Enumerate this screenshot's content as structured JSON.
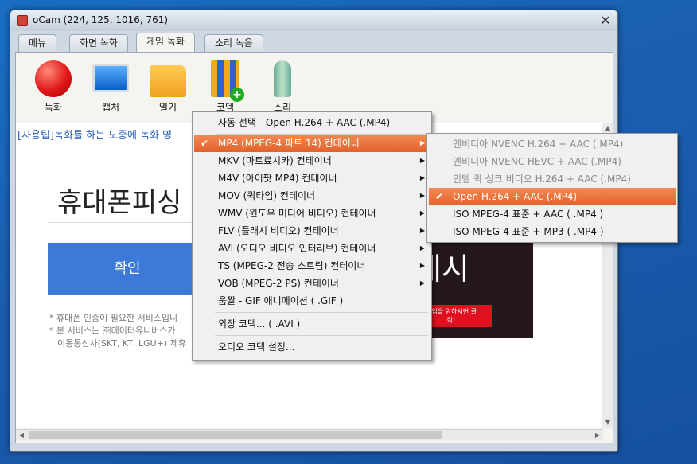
{
  "window": {
    "title": "oCam (224, 125, 1016, 761)",
    "close_glyph": "✕"
  },
  "tabs": [
    {
      "label": "메뉴"
    },
    {
      "label": "화면 녹화"
    },
    {
      "label": "게임 녹화"
    },
    {
      "label": "소리 녹음"
    }
  ],
  "toolbar": {
    "record": "녹화",
    "capture": "캡처",
    "open": "열기",
    "codec": "코덱",
    "sound": "소리"
  },
  "content": {
    "tip": "[사용팁]녹화를 하는 도중에 녹화 영",
    "heading": "휴대폰피싱",
    "confirm_button": "확인",
    "note1": "* 휴대폰 인증이 필요한 서비스입니",
    "note2": "* 본 서비스는 ㈜데이터유니버스가",
    "note3": "이동통신사(SKT, KT, LGU+) 제휴",
    "ad_big": "게시",
    "ad_button": "게임을 원하시면 클릭!",
    "ad_close": "✕"
  },
  "codec_menu": {
    "items": [
      {
        "label": "자동 선택 - Open H.264 + AAC (.MP4)"
      },
      {
        "label": "MP4 (MPEG-4 파트 14) 컨테이너",
        "checked": true,
        "submenu": true
      },
      {
        "label": "MKV (마트료시카) 컨테이너",
        "submenu": true
      },
      {
        "label": "M4V (아이팟 MP4) 컨테이너",
        "submenu": true
      },
      {
        "label": "MOV (퀵타임) 컨테이너",
        "submenu": true
      },
      {
        "label": "WMV (윈도우 미디어 비디오) 컨테이너",
        "submenu": true
      },
      {
        "label": "FLV (플래시 비디오) 컨테이너",
        "submenu": true
      },
      {
        "label": "AVI (오디오 비디오 인터리브) 컨테이너",
        "submenu": true
      },
      {
        "label": "TS (MPEG-2 전송 스트림) 컨테이너",
        "submenu": true
      },
      {
        "label": "VOB (MPEG-2 PS) 컨테이너",
        "submenu": true
      },
      {
        "label": "움짤 - GIF 애니메이션 ( .GIF )"
      },
      {
        "label": "외장 코덱... ( .AVI )"
      },
      {
        "label": "오디오 코덱 설정..."
      }
    ]
  },
  "mp4_submenu": {
    "items": [
      {
        "label": "엔비디아 NVENC H.264 + AAC (.MP4)",
        "disabled": true
      },
      {
        "label": "엔비디아 NVENC HEVC + AAC (.MP4)",
        "disabled": true
      },
      {
        "label": "인텔 퀵 싱크 비디오 H.264 + AAC (.MP4)",
        "disabled": true
      },
      {
        "label": "Open H.264 + AAC (.MP4)",
        "checked": true
      },
      {
        "label": "ISO MPEG-4 표준 + AAC ( .MP4 )"
      },
      {
        "label": "ISO MPEG-4 표준 + MP3 ( .MP4 )"
      }
    ]
  },
  "glyphs": {
    "check": "✔",
    "submenu_arrow": "▶",
    "up": "▲",
    "down": "▼",
    "left": "◀",
    "right": "▶"
  }
}
